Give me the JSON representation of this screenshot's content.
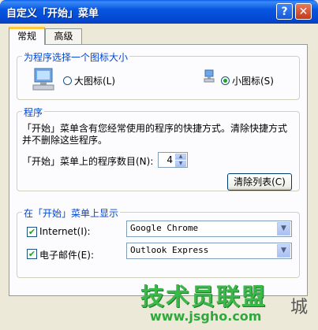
{
  "window": {
    "title": "自定义「开始」菜单",
    "help_glyph": "?",
    "close_glyph": "✕"
  },
  "tabs": [
    {
      "label": "常规"
    },
    {
      "label": "高级"
    }
  ],
  "icon_size_group": {
    "label": "为程序选择一个图标大小",
    "large_label": "大图标(L)",
    "small_label": "小图标(S)",
    "selected": "small"
  },
  "programs_group": {
    "label": "程序",
    "description_line1": "「开始」菜单含有您经常使用的程序的快捷方式。清除快捷方式",
    "description_line2": "并不删除这些程序。",
    "count_label": "「开始」菜单上的程序数目(N):",
    "count_value": "4",
    "clear_button": "清除列表(C)"
  },
  "show_group": {
    "label": "在「开始」菜单上显示",
    "internet_label": "Internet(I):",
    "internet_checked": true,
    "internet_value": "Google Chrome",
    "email_label": "电子邮件(E):",
    "email_checked": true,
    "email_value": "Outlook Express"
  },
  "watermark": {
    "text": "技术员联盟",
    "url": "www.jsgho.com",
    "suffix": "城"
  }
}
